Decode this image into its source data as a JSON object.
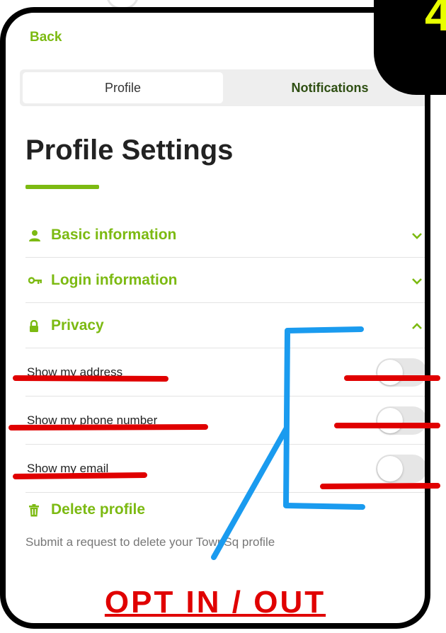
{
  "header": {
    "back_label": "Back"
  },
  "tabs": [
    {
      "label": "Profile",
      "selected": true
    },
    {
      "label": "Notifications",
      "selected": false
    }
  ],
  "page_title": "Profile Settings",
  "sections": [
    {
      "label": "Basic information",
      "icon": "person-icon",
      "expanded": false
    },
    {
      "label": "Login information",
      "icon": "key-icon",
      "expanded": false
    },
    {
      "label": "Privacy",
      "icon": "lock-icon",
      "expanded": true
    }
  ],
  "privacy": {
    "rows": [
      {
        "label": "Show my address",
        "on": false
      },
      {
        "label": "Show my phone number",
        "on": false
      },
      {
        "label": "Show my email",
        "on": false
      }
    ]
  },
  "delete": {
    "label": "Delete profile",
    "icon": "trash-icon",
    "description": "Submit a request to delete your TownSq profile"
  },
  "annotation": {
    "caption": "OPT IN / OUT",
    "badge": "4"
  },
  "colors": {
    "accent": "#7cba12",
    "annotation_red": "#e00000",
    "annotation_blue": "#1a9bef",
    "badge_yellow": "#e8ff00"
  }
}
